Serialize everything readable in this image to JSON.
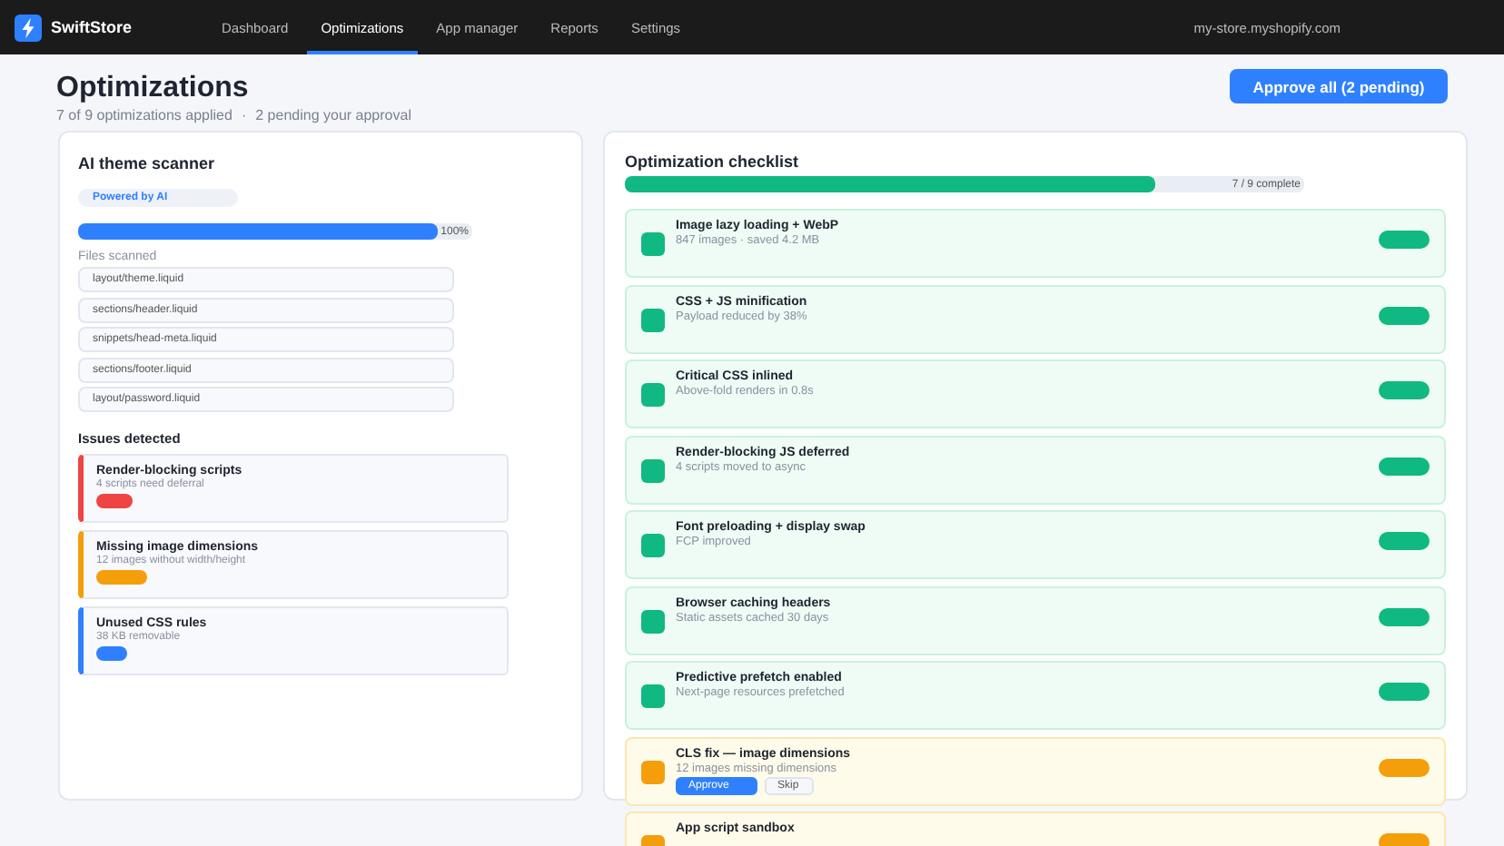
{
  "brand": {
    "name": "SwiftStore"
  },
  "nav": [
    {
      "label": "Dashboard",
      "selected": false
    },
    {
      "label": "Optimizations",
      "selected": true
    },
    {
      "label": "App manager",
      "selected": false
    },
    {
      "label": "Reports",
      "selected": false
    },
    {
      "label": "Settings",
      "selected": false
    }
  ],
  "store_domain": "my-store.myshopify.com",
  "header": {
    "title": "Optimizations",
    "applied": "7 of 9 optimizations applied",
    "separator": "·",
    "pending": "2 pending your approval",
    "approve_all": "Approve all (2 pending)"
  },
  "scanner": {
    "title": "AI theme scanner",
    "badge": "Powered by AI",
    "reading": "100%",
    "files_label": "Files scanned",
    "files": [
      "layout/theme.liquid",
      "sections/header.liquid",
      "snippets/head-meta.liquid",
      "sections/footer.liquid",
      "layout/password.liquid"
    ],
    "issues_label": "Issues detected",
    "issues": [
      {
        "title": "Render-blocking scripts",
        "detail": "4 scripts need deferral",
        "color": "#ef4444"
      },
      {
        "title": "Missing image dimensions",
        "detail": "12 images without width/height",
        "color": "#f59e0b"
      },
      {
        "title": "Unused CSS rules",
        "detail": "38 KB removable",
        "color": "#2f80ff"
      }
    ]
  },
  "checklist": {
    "title": "Optimization checklist",
    "level": 0.78,
    "reading": "7 / 9 complete",
    "items": [
      {
        "title": "Image lazy loading + WebP",
        "detail": "847 images · saved 4.2 MB",
        "applied": true
      },
      {
        "title": "CSS + JS minification",
        "detail": "Payload reduced by 38%",
        "applied": true
      },
      {
        "title": "Critical CSS inlined",
        "detail": "Above-fold renders in 0.8s",
        "applied": true
      },
      {
        "title": "Render-blocking JS deferred",
        "detail": "4 scripts moved to async",
        "applied": true
      },
      {
        "title": "Font preloading + display swap",
        "detail": "FCP improved",
        "applied": true
      },
      {
        "title": "Browser caching headers",
        "detail": "Static assets cached 30 days",
        "applied": true
      },
      {
        "title": "Predictive prefetch enabled",
        "detail": "Next-page resources prefetched",
        "applied": true
      },
      {
        "title": "CLS fix — image dimensions",
        "detail": "12 images missing dimensions",
        "applied": false,
        "actions": [
          "Approve",
          "Skip"
        ]
      },
      {
        "title": "App script sandbox",
        "applied": false
      }
    ]
  }
}
